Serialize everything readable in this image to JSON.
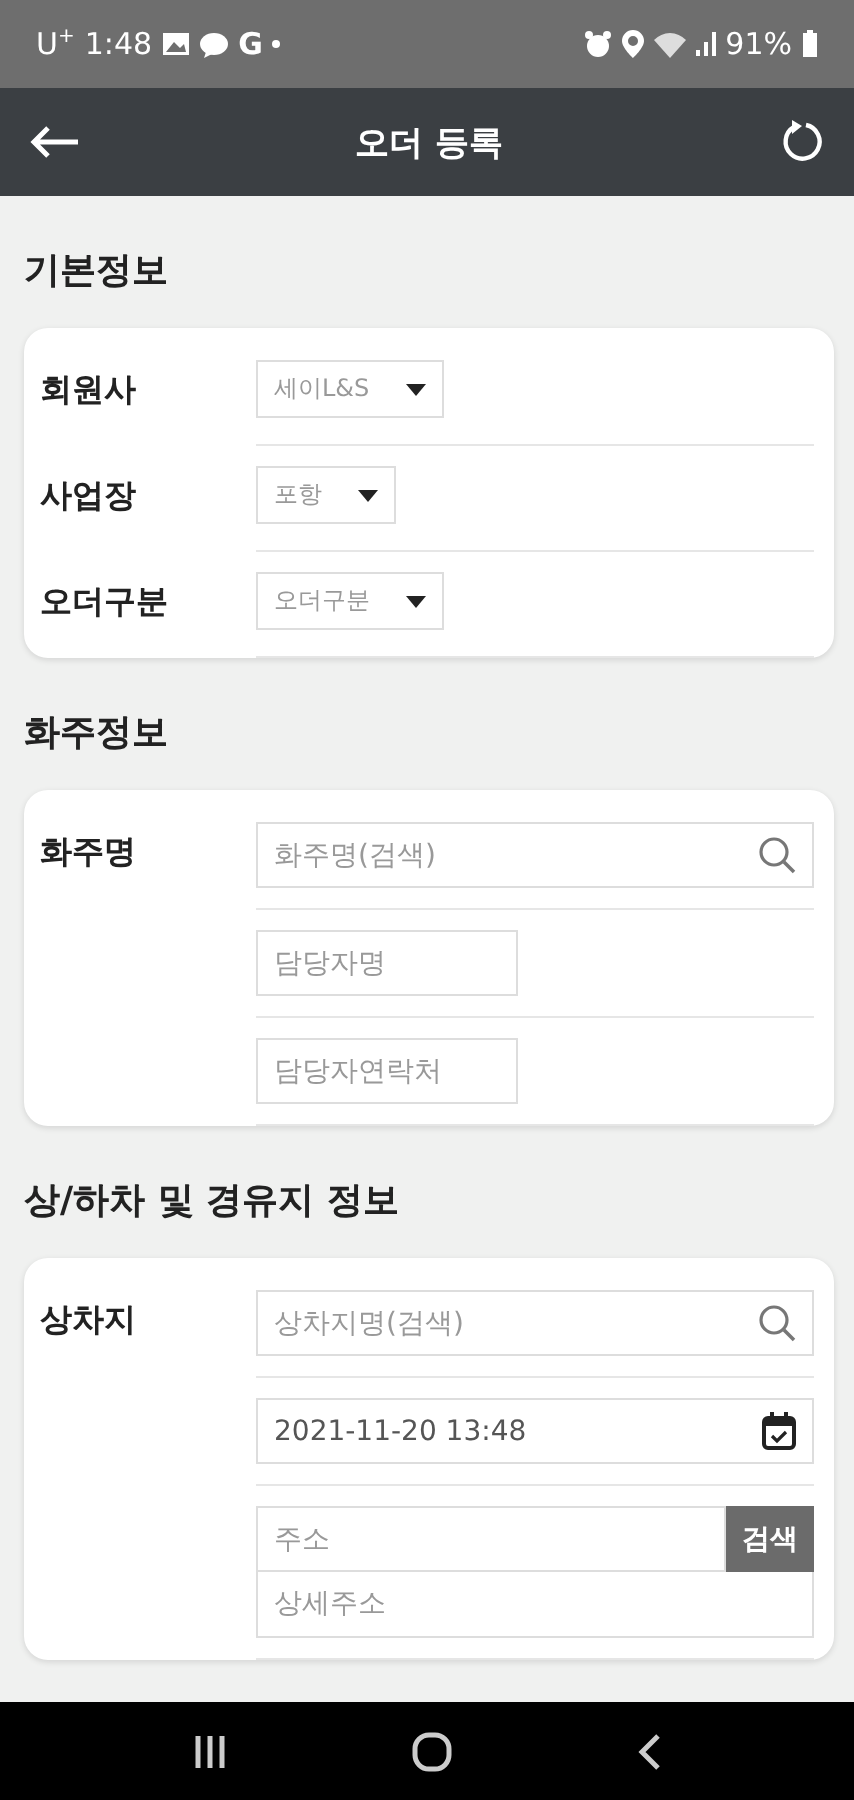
{
  "status_bar": {
    "carrier": "U$^{+}$",
    "time": "1:48",
    "notification": "G",
    "battery": "91%"
  },
  "header": {
    "title": "오더 등록"
  },
  "sections": [
    {
      "title": "기본정보",
      "rows": [
        {
          "label": "회원사",
          "field": {
            "kind": "dropdown",
            "value": "세이L&S"
          }
        },
        {
          "label": "사업장",
          "field": {
            "kind": "dropdown",
            "value": "포항"
          }
        },
        {
          "label": "오더구분",
          "field": {
            "kind": "dropdown",
            "value": "오더구분"
          }
        }
      ]
    },
    {
      "title": "화주정보",
      "rows": [
        {
          "label": "화주명",
          "field": {
            "kind": "search",
            "placeholder": "화주명(검색)"
          }
        },
        {
          "field": {
            "kind": "text",
            "placeholder": "담당자명"
          }
        },
        {
          "field": {
            "kind": "text",
            "placeholder": "담당자연락처"
          }
        }
      ]
    },
    {
      "title": "상/하차 및 경유지 정보",
      "rows": [
        {
          "label": "상차지",
          "field": {
            "kind": "search",
            "placeholder": "상차지명(검색)"
          }
        },
        {
          "field": {
            "kind": "date",
            "value": "2021-11-20 13:48"
          }
        },
        {
          "field": {
            "kind": "address",
            "placeholder": "주소",
            "button": "검색",
            "detail_placeholder": "상세주소"
          }
        }
      ]
    }
  ]
}
